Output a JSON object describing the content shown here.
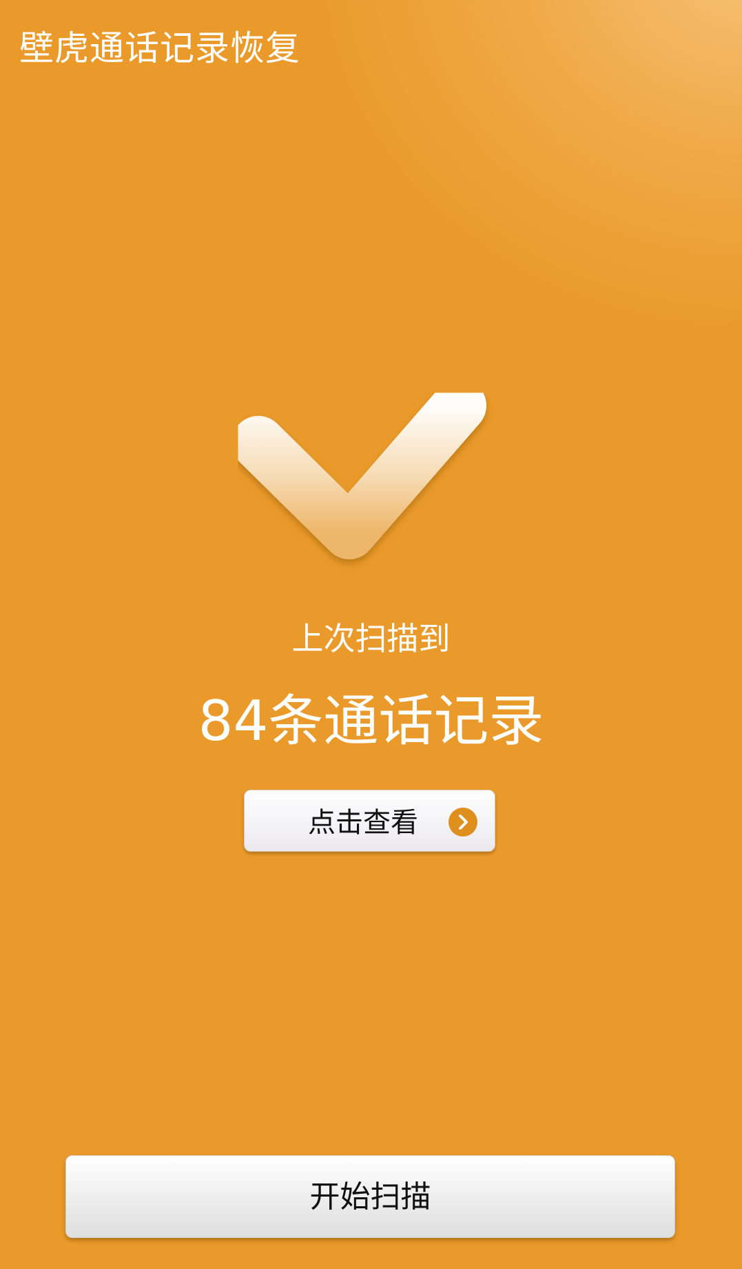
{
  "app": {
    "title": "壁虎通话记录恢复"
  },
  "status": {
    "last_scan_label": "上次扫描到",
    "result_count": "84条通话记录"
  },
  "buttons": {
    "view_label": "点击查看",
    "start_scan_label": "开始扫描"
  },
  "icons": {
    "check": "checkmark-icon",
    "arrow": "chevron-right-icon"
  },
  "colors": {
    "background": "#ea9a2a",
    "accent": "#df8f1d",
    "text_light": "#ffffff",
    "button_text": "#111111"
  }
}
